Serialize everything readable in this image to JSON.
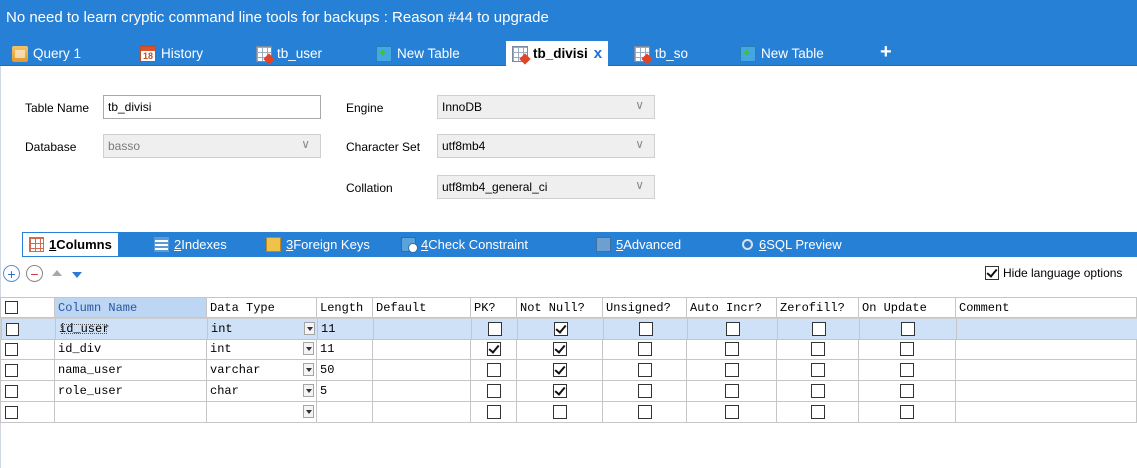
{
  "banner": "No need to learn cryptic command line tools for backups : Reason #44 to upgrade",
  "tabs": [
    {
      "label": "Query 1",
      "icon": "query-icon"
    },
    {
      "label": "History",
      "icon": "calendar-icon",
      "icon_text": "18"
    },
    {
      "label": "tb_user",
      "icon": "table-icon"
    },
    {
      "label": "New Table",
      "icon": "new-table-icon"
    },
    {
      "label": "tb_divisi",
      "icon": "table-icon",
      "active": true
    },
    {
      "label": "tb_so",
      "icon": "table-icon"
    },
    {
      "label": "New Table",
      "icon": "new-table-icon"
    }
  ],
  "add_tab": "+",
  "close_tab": "x",
  "form": {
    "table_name_label": "Table Name",
    "table_name_value": "tb_divisi",
    "database_label": "Database",
    "database_value": "basso",
    "engine_label": "Engine",
    "engine_value": "InnoDB",
    "charset_label": "Character Set",
    "charset_value": "utf8mb4",
    "collation_label": "Collation",
    "collation_value": "utf8mb4_general_ci",
    "chevron": "∨"
  },
  "subtabs": [
    {
      "num": "1",
      "label": " Columns",
      "icon": "grid-icon",
      "active": true
    },
    {
      "num": "2",
      "label": " Indexes",
      "icon": "indexes-icon"
    },
    {
      "num": "3",
      "label": " Foreign Keys",
      "icon": "key-icon"
    },
    {
      "num": "4",
      "label": " Check Constraint",
      "icon": "check-constraint-icon"
    },
    {
      "num": "5",
      "label": " Advanced",
      "icon": "advanced-icon"
    },
    {
      "num": "6",
      "label": " SQL Preview",
      "icon": "sql-preview-icon"
    }
  ],
  "toolbar": {
    "add": "+",
    "remove": "−",
    "hide_language_options": "Hide language options",
    "hide_language_checked": true
  },
  "grid": {
    "headers": [
      "Column Name",
      "Data Type",
      "Length",
      "Default",
      "PK?",
      "Not Null?",
      "Unsigned?",
      "Auto Incr?",
      "Zerofill?",
      "On Update",
      "Comment"
    ],
    "rows": [
      {
        "name": "id_user",
        "type": "int",
        "length": "11",
        "default": "",
        "pk": false,
        "notnull": true,
        "unsigned": false,
        "autoincr": false,
        "zerofill": false,
        "onupdate": false,
        "comment": "",
        "selected": true
      },
      {
        "name": "id_div",
        "type": "int",
        "length": "11",
        "default": "",
        "pk": true,
        "notnull": true,
        "unsigned": false,
        "autoincr": false,
        "zerofill": false,
        "onupdate": false,
        "comment": ""
      },
      {
        "name": "nama_user",
        "type": "varchar",
        "length": "50",
        "default": "",
        "pk": false,
        "notnull": true,
        "unsigned": false,
        "autoincr": false,
        "zerofill": false,
        "onupdate": false,
        "comment": ""
      },
      {
        "name": "role_user",
        "type": "char",
        "length": "5",
        "default": "",
        "pk": false,
        "notnull": true,
        "unsigned": false,
        "autoincr": false,
        "zerofill": false,
        "onupdate": false,
        "comment": ""
      },
      {
        "name": "",
        "type": "",
        "length": "",
        "default": "",
        "pk": false,
        "notnull": false,
        "unsigned": false,
        "autoincr": false,
        "zerofill": false,
        "onupdate": false,
        "comment": ""
      }
    ]
  }
}
